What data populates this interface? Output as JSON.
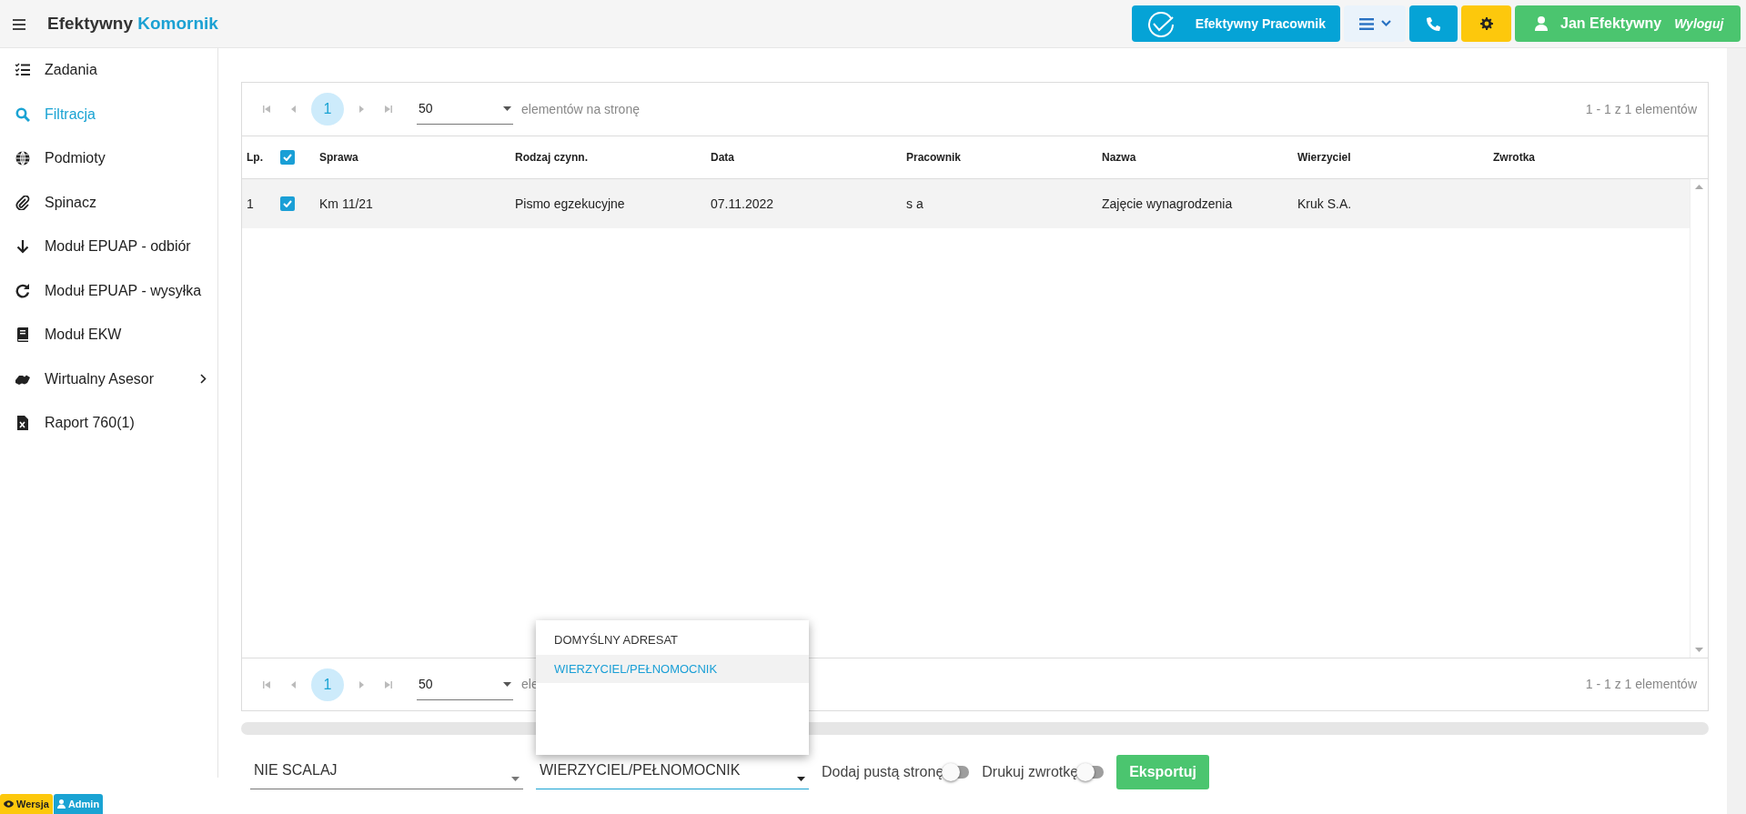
{
  "header": {
    "brand": "Efektywny",
    "brand_accent": "Komornik"
  },
  "top_buttons": [
    {
      "kind": "app",
      "label": "Efektywny Pracownik"
    },
    {
      "kind": "menu"
    },
    {
      "kind": "phone"
    },
    {
      "kind": "settings"
    },
    {
      "kind": "user",
      "label": "Jan Efektywny",
      "action": "Wyloguj"
    }
  ],
  "sidebar": {
    "items": [
      {
        "label": "Zadania",
        "selected": false,
        "submenu": false
      },
      {
        "label": "Filtracja",
        "selected": true,
        "submenu": false
      },
      {
        "label": "Podmioty",
        "selected": false,
        "submenu": false
      },
      {
        "label": "Spinacz",
        "selected": false,
        "submenu": false
      },
      {
        "label": "Moduł EPUAP - odbiór",
        "selected": false,
        "submenu": false
      },
      {
        "label": "Moduł EPUAP - wysyłka",
        "selected": false,
        "submenu": false
      },
      {
        "label": "Moduł EKW",
        "selected": false,
        "submenu": false
      },
      {
        "label": "Wirtualny Asesor",
        "selected": false,
        "submenu": true
      },
      {
        "label": "Raport 760(1)",
        "selected": false,
        "submenu": false
      }
    ]
  },
  "pager_top": {
    "page": "1",
    "page_size": "50",
    "per_page_label": "elementów na stronę",
    "summary": "1 - 1 z 1 elementów"
  },
  "table": {
    "columns": [
      "Lp.",
      "Sprawa",
      "Rodzaj czynn.",
      "Data",
      "Pracownik",
      "Nazwa",
      "Wierzyciel",
      "Zwrotka"
    ],
    "header_checked": true,
    "rows": [
      {
        "selected": true,
        "checked": true,
        "cells": [
          "1",
          "Km 11/21",
          "Pismo egzekucyjne",
          "07.11.2022",
          "s a",
          "Zajęcie wynagrodzenia",
          "Kruk S.A."
        ]
      }
    ]
  },
  "pager_bottom": {
    "page": "1",
    "page_size": "50",
    "per_page_label": "ele",
    "summary": "1 - 1 z 1 elementów"
  },
  "controls": {
    "merge_select": {
      "value": "NIE SCALAJ"
    },
    "recipient_select": {
      "value": "WIERZYCIEL/PEŁNOMOCNIK",
      "open": true,
      "options": [
        {
          "label": "DOMYŚLNY ADRESAT",
          "selected": false
        },
        {
          "label": "WIERZYCIEL/PEŁNOMOCNIK",
          "selected": true
        }
      ]
    },
    "toggles": [
      {
        "label": "Dodaj pustą stronę",
        "on": false
      },
      {
        "label": "Drukuj zwrotkę",
        "on": false
      }
    ],
    "export_button": "Eksportuj"
  },
  "badges": [
    {
      "kind": "version",
      "label": "Wersja"
    },
    {
      "kind": "admin",
      "label": "Admin"
    }
  ]
}
